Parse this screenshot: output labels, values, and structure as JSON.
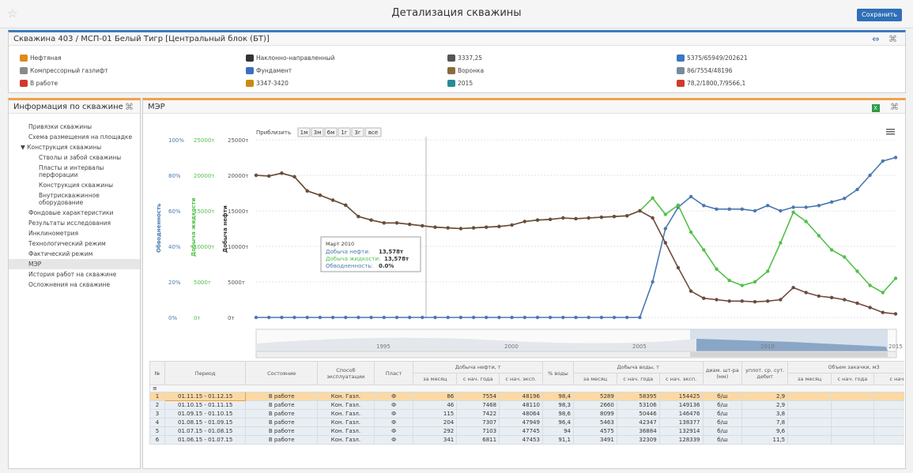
{
  "header": {
    "title": "Детализация скважины",
    "save_label": "Сохранить"
  },
  "well": {
    "title": "Скважина 403 / МСП-01 Белый Тигр [Центральный блок (БТ)]",
    "columns": [
      [
        {
          "icon": "oil-drop-icon",
          "color": "#e08a1e",
          "text": "Нефтяная"
        },
        {
          "icon": "gas-lift-icon",
          "color": "#8a8a8a",
          "text": "Компрессорный газлифт"
        },
        {
          "icon": "working-status-icon",
          "color": "#d03a2a",
          "text": "В работе"
        }
      ],
      [
        {
          "icon": "directional-well-icon",
          "color": "#333333",
          "text": "Наклонно-направленный"
        },
        {
          "icon": "foundation-icon",
          "color": "#3a6fc0",
          "text": "Фундамент"
        },
        {
          "icon": "interval-icon",
          "color": "#c98a12",
          "text": "3347-3420"
        }
      ],
      [
        {
          "icon": "depth-icon",
          "color": "#555555",
          "text": "3337,25"
        },
        {
          "icon": "funnel-icon",
          "color": "#8a6a3a",
          "text": "Воронка"
        },
        {
          "icon": "year-icon",
          "color": "#2a8a9a",
          "text": "2015"
        }
      ],
      [
        {
          "icon": "oil-production-icon",
          "color": "#3a78c0",
          "text": "5375/65949/202621"
        },
        {
          "icon": "water-production-icon",
          "color": "#7a8a9a",
          "text": "86/7554/48196"
        },
        {
          "icon": "water-cut-icon",
          "color": "#d03a2a",
          "text": "78,2/1800,7/9566,1"
        }
      ]
    ]
  },
  "sidebar": {
    "title": "Информация по скважине",
    "items": [
      {
        "label": "Привязки скважины",
        "level": 1
      },
      {
        "label": "Схема размещения на площадке",
        "level": 1
      },
      {
        "label": "Конструкция скважины",
        "level": 0
      },
      {
        "label": "Стволы и забой скважины",
        "level": 2
      },
      {
        "label": "Пласты и интервалы перфорации",
        "level": 2
      },
      {
        "label": "Конструкция скважины",
        "level": 2
      },
      {
        "label": "Внутрискважинное оборудование",
        "level": 2
      },
      {
        "label": "Фондовые характеристики",
        "level": 1
      },
      {
        "label": "Результаты исследования",
        "level": 1
      },
      {
        "label": "Инклинометрия",
        "level": 1
      },
      {
        "label": "Технологический режим",
        "level": 1
      },
      {
        "label": "Фактический режим",
        "level": 1
      },
      {
        "label": "МЭР",
        "level": 1,
        "active": true
      },
      {
        "label": "История работ на скважине",
        "level": 1
      },
      {
        "label": "Осложнения на скважине",
        "level": 1
      }
    ]
  },
  "mer": {
    "title": "МЭР",
    "zoom_label": "Приблизить",
    "zoom_buttons": [
      "1м",
      "3м",
      "6м",
      "1г",
      "3г",
      "все"
    ],
    "axes": {
      "watercut_title": "Обводненность",
      "liquid_title": "Добыча жидкости",
      "oil_title": "Добыча нефти",
      "watercut_ticks": [
        "100%",
        "80%",
        "60%",
        "40%",
        "20%",
        "0%"
      ],
      "liquid_ticks": [
        "25000т",
        "20000т",
        "15000т",
        "10000т",
        "5000т",
        "0т"
      ],
      "oil_ticks": [
        "25000т",
        "20000т",
        "15000т",
        "10000т",
        "5000т",
        "0т"
      ]
    },
    "navigator_years": [
      "1995",
      "2000",
      "2005",
      "2010",
      "2015"
    ],
    "tooltip": {
      "date": "Март 2010",
      "oil_label": "Добыча нефти:",
      "oil_value": "13,578т",
      "liquid_label": "Добыча жидкости:",
      "liquid_value": "13,578т",
      "watercut_label": "Обводненность:",
      "watercut_value": "0.0%"
    },
    "colors": {
      "watercut": "#4a78b0",
      "liquid": "#52c04a",
      "oil": "#6e4a3c"
    }
  },
  "table": {
    "group_headers": {
      "num": "№",
      "period": "Период",
      "status": "Состояние",
      "method": "Способ эксплуатации",
      "formation": "Пласт",
      "oil": "Добыча нефти, т",
      "water_pct": "% воды",
      "water": "Добыча воды, т",
      "diameter": "диам. шт-ра (мм)",
      "density": "уплот. ср. сут. дебит",
      "injection": "Объем закачки, м3"
    },
    "sub_headers": {
      "month": "за месяц",
      "year": "с нач. года",
      "total": "с нач. эксп.",
      "total_cut": "с нач"
    },
    "rows": [
      {
        "n": "1",
        "period": "01.11.15 - 01.12.15",
        "status": "В работе",
        "method": "Кон. Газл.",
        "formation": "Ф",
        "oil_m": "86",
        "oil_y": "7554",
        "oil_t": "48196",
        "wpct": "98,4",
        "w_m": "5289",
        "w_y": "58395",
        "w_t": "154425",
        "diam": "б/ш",
        "dens": "2,9"
      },
      {
        "n": "2",
        "period": "01.10.15 - 01.11.15",
        "status": "В работе",
        "method": "Кон. Газл.",
        "formation": "Ф",
        "oil_m": "46",
        "oil_y": "7468",
        "oil_t": "48110",
        "wpct": "98,3",
        "w_m": "2660",
        "w_y": "53106",
        "w_t": "149136",
        "diam": "б/ш",
        "dens": "2,9"
      },
      {
        "n": "3",
        "period": "01.09.15 - 01.10.15",
        "status": "В работе",
        "method": "Кон. Газл.",
        "formation": "Ф",
        "oil_m": "115",
        "oil_y": "7422",
        "oil_t": "48064",
        "wpct": "98,6",
        "w_m": "8099",
        "w_y": "50446",
        "w_t": "146476",
        "diam": "б/ш",
        "dens": "3,8"
      },
      {
        "n": "4",
        "period": "01.08.15 - 01.09.15",
        "status": "В работе",
        "method": "Кон. Газл.",
        "formation": "Ф",
        "oil_m": "204",
        "oil_y": "7307",
        "oil_t": "47949",
        "wpct": "96,4",
        "w_m": "5463",
        "w_y": "42347",
        "w_t": "138377",
        "diam": "б/ш",
        "dens": "7,8"
      },
      {
        "n": "5",
        "period": "01.07.15 - 01.08.15",
        "status": "В работе",
        "method": "Кон. Газл.",
        "formation": "Ф",
        "oil_m": "292",
        "oil_y": "7103",
        "oil_t": "47745",
        "wpct": "94",
        "w_m": "4575",
        "w_y": "36884",
        "w_t": "132914",
        "diam": "б/ш",
        "dens": "9,6"
      },
      {
        "n": "6",
        "period": "01.06.15 - 01.07.15",
        "status": "В работе",
        "method": "Кон. Газл.",
        "formation": "Ф",
        "oil_m": "341",
        "oil_y": "6811",
        "oil_t": "47453",
        "wpct": "91,1",
        "w_m": "3491",
        "w_y": "32309",
        "w_t": "128339",
        "diam": "б/ш",
        "dens": "11,5"
      }
    ]
  },
  "chart_data": {
    "type": "line",
    "title": "",
    "x": [
      1990,
      1990.5,
      1991,
      1991.5,
      1992,
      1992.5,
      1993,
      1993.5,
      1994,
      1994.5,
      1995,
      1995.5,
      1996,
      1996.5,
      1997,
      1997.5,
      1998,
      1998.5,
      1999,
      1999.5,
      2000,
      2000.5,
      2001,
      2001.5,
      2002,
      2002.5,
      2003,
      2003.5,
      2004,
      2004.5,
      2005,
      2005.5,
      2006,
      2006.5,
      2007,
      2007.5,
      2008,
      2008.5,
      2009,
      2009.5,
      2010,
      2010.5,
      2011,
      2011.5,
      2012,
      2012.5,
      2013,
      2013.5,
      2014,
      2014.5,
      2015
    ],
    "series": [
      {
        "name": "Добыча нефти",
        "unit": "т",
        "values": [
          20000,
          19900,
          20300,
          19800,
          17800,
          17200,
          16500,
          15800,
          14200,
          13700,
          13300,
          13300,
          13100,
          12900,
          12700,
          12600,
          12500,
          12600,
          12700,
          12800,
          13000,
          13500,
          13700,
          13800,
          14000,
          13900,
          14000,
          14100,
          14200,
          14300,
          15000,
          14000,
          10500,
          7000,
          3700,
          2700,
          2500,
          2300,
          2300,
          2200,
          2300,
          2500,
          4200,
          3500,
          3000,
          2800,
          2500,
          2000,
          1400,
          700,
          500
        ]
      },
      {
        "name": "Добыча жидкости",
        "unit": "т",
        "values": [
          20000,
          19900,
          20300,
          19800,
          17800,
          17200,
          16500,
          15800,
          14200,
          13700,
          13300,
          13300,
          13100,
          12900,
          12700,
          12600,
          12500,
          12600,
          12700,
          12800,
          13000,
          13500,
          13700,
          13800,
          14000,
          13900,
          14000,
          14100,
          14200,
          14300,
          15000,
          16800,
          14500,
          15800,
          12000,
          9500,
          6800,
          5200,
          4500,
          5000,
          6500,
          10500,
          14800,
          13500,
          11500,
          9500,
          8500,
          6500,
          4500,
          3500,
          5500
        ]
      },
      {
        "name": "Обводненность",
        "unit": "%",
        "values": [
          0,
          0,
          0,
          0,
          0,
          0,
          0,
          0,
          0,
          0,
          0,
          0,
          0,
          0,
          0,
          0,
          0,
          0,
          0,
          0,
          0,
          0,
          0,
          0,
          0,
          0,
          0,
          0,
          0,
          0,
          0,
          20,
          50,
          62,
          68,
          63,
          61,
          61,
          61,
          60,
          63,
          60,
          62,
          62,
          63,
          65,
          67,
          72,
          80,
          88,
          90
        ]
      }
    ],
    "xlim": [
      1990,
      2015
    ],
    "ylim_mass": [
      0,
      25000
    ],
    "ylim_pct": [
      0,
      100
    ]
  }
}
